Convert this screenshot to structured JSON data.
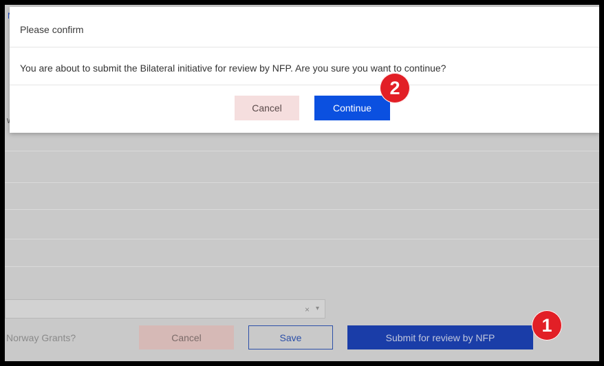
{
  "background": {
    "top_link": "N",
    "left_letter": "w",
    "combo_clear": "×",
    "combo_caret": "▾",
    "question_text": "Norway Grants?",
    "buttons": {
      "cancel": "Cancel",
      "save": "Save",
      "submit": "Submit for review by NFP"
    }
  },
  "dialog": {
    "title": "Please confirm",
    "message": "You are about to submit the Bilateral initiative for review by NFP. Are you sure you want to continue?",
    "buttons": {
      "cancel": "Cancel",
      "continue": "Continue"
    }
  },
  "annotations": {
    "step_1": "1",
    "step_2": "2"
  },
  "colors": {
    "primary": "#0b50e0",
    "cancel_bg": "#f5dede",
    "badge": "#e21f26",
    "overlay": "#c9c9c9"
  }
}
